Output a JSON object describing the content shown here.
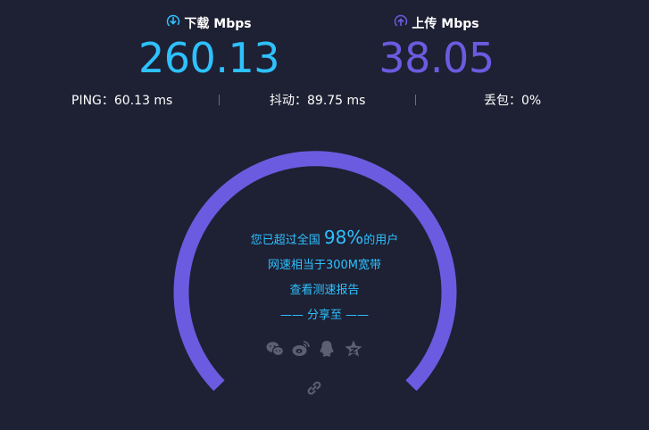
{
  "download": {
    "label": "下载 Mbps",
    "value": "260.13",
    "color": "#2ec1ff"
  },
  "upload": {
    "label": "上传 Mbps",
    "value": "38.05",
    "color": "#6b5be0"
  },
  "stats": {
    "ping": "PING：60.13 ms",
    "jitter": "抖动：89.75 ms",
    "loss": "丢包：0%"
  },
  "gauge": {
    "color": "#6b5be0"
  },
  "summary": {
    "prefix": "您已超过全国",
    "percent": "98%",
    "suffix": "的用户",
    "equivalent": "网速相当于300M宽带",
    "report_link": "查看测速报告",
    "share_to": "—— 分享至 ——"
  },
  "share": {
    "icons": [
      "wechat-icon",
      "weibo-icon",
      "qq-icon",
      "qzone-icon",
      "link-icon"
    ],
    "icon_color": "#5b5f72"
  }
}
